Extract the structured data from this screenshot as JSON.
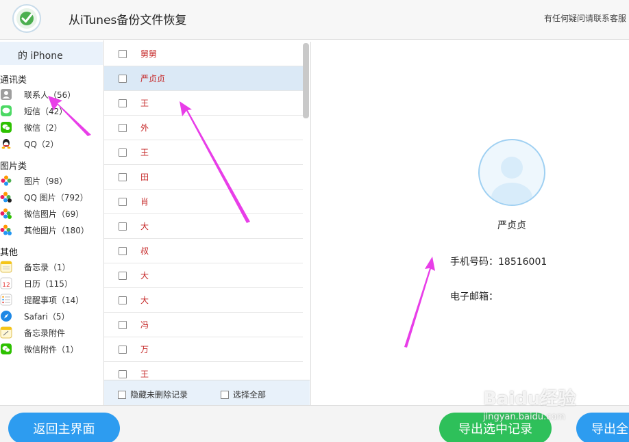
{
  "header": {
    "title": "从iTunes备份文件恢复",
    "support": "有任何疑问请联系客服"
  },
  "sidebar": {
    "device": "的 iPhone",
    "categories": [
      {
        "title": "通讯类",
        "items": [
          {
            "icon": "contacts-icon",
            "label": "联系人（56）"
          },
          {
            "icon": "messages-icon",
            "label": "短信（42）"
          },
          {
            "icon": "wechat-icon",
            "label": "微信（2）"
          },
          {
            "icon": "qq-icon",
            "label": "QQ（2）"
          }
        ]
      },
      {
        "title": "图片类",
        "items": [
          {
            "icon": "photos-icon",
            "label": "图片（98）"
          },
          {
            "icon": "qq-photos-icon",
            "label": "QQ 图片（792）"
          },
          {
            "icon": "wechat-photos-icon",
            "label": "微信图片（69）"
          },
          {
            "icon": "other-photos-icon",
            "label": "其他图片（180）"
          }
        ]
      },
      {
        "title": "其他",
        "items": [
          {
            "icon": "notes-icon",
            "label": "备忘录（1）"
          },
          {
            "icon": "calendar-icon",
            "label": "日历（115）"
          },
          {
            "icon": "reminders-icon",
            "label": "提醒事项（14）"
          },
          {
            "icon": "safari-icon",
            "label": "Safari（5）"
          },
          {
            "icon": "notes-attachment-icon",
            "label": "备忘录附件"
          },
          {
            "icon": "wechat-attachment-icon",
            "label": "微信附件（1）"
          }
        ]
      }
    ]
  },
  "list": {
    "rows": [
      "舅舅",
      "严贞贞",
      "王",
      "外",
      "王",
      "田",
      "肖",
      "大",
      "叔",
      "大",
      "大",
      "冯",
      "万",
      "王"
    ],
    "selected_index": 1
  },
  "list_footer": {
    "hide_deleted": "隐藏未删除记录",
    "select_all": "选择全部"
  },
  "detail": {
    "name": "严贞贞",
    "phone_label": "手机号码：",
    "phone_value": "18516001",
    "email_label": "电子邮箱："
  },
  "buttons": {
    "back": "返回主界面",
    "export_selected": "导出选中记录",
    "export_all": "导出全"
  },
  "watermark": {
    "main": "Baidu经验",
    "sub": "jingyan.baidu.com"
  },
  "colors": {
    "accent_blue": "#2d9cf0",
    "accent_green": "#2ec05a",
    "arrow": "#e83ee8",
    "list_text": "#c62828"
  }
}
